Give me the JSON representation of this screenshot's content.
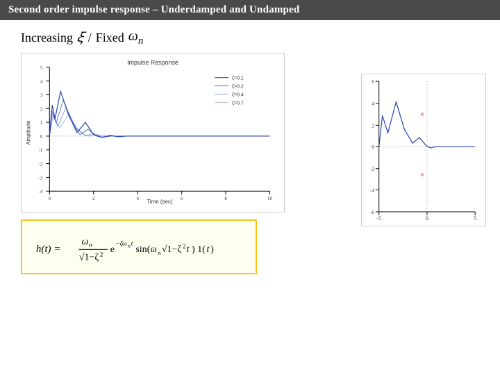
{
  "header": {
    "title": "Second order impulse response – Underdamped and Undamped"
  },
  "subtitle": {
    "prefix": "Increasing",
    "zeta_symbol": "ξ",
    "slash": "/",
    "fixed_text": "Fixed",
    "omega_symbol": "ωn"
  },
  "left_plot": {
    "title": "Impulse Response",
    "x_label": "Time (sec)",
    "y_label": "Amplitude",
    "x_ticks": [
      "0",
      "2",
      "4",
      "6",
      "8",
      "10"
    ],
    "y_ticks": [
      "-4",
      "-3",
      "-2",
      "-1",
      "0",
      "1",
      "2",
      "3",
      "4",
      "5"
    ]
  },
  "right_plot": {
    "x_ticks": [
      "-5",
      "0",
      "5"
    ],
    "y_ticks": [
      "-6",
      "-4",
      "-2",
      "0",
      "2",
      "4",
      "6"
    ]
  },
  "formula": {
    "text": "h(t) = (ωn / √(1−ζ²)) · e^(−ζωnt) · sin(ωn√(1−ζ²t)) · 1(t)"
  }
}
